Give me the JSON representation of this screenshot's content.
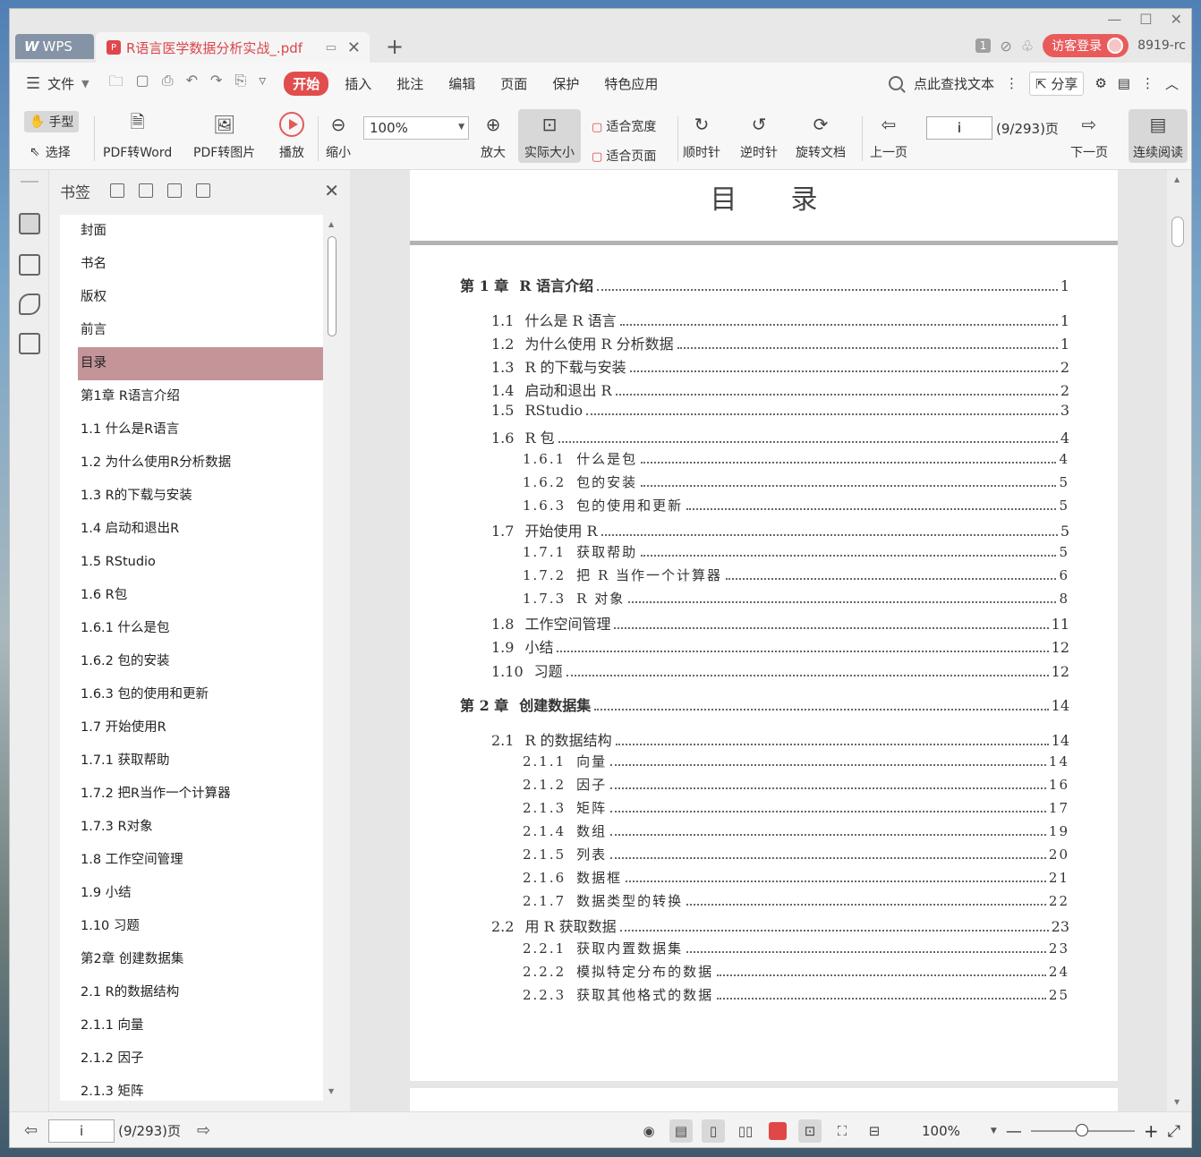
{
  "titlebar": {
    "app_name": "WPS",
    "doc_tab_title": "R语言医学数据分析实战_.pdf",
    "badge_count": "1",
    "guest_login": "访客登录",
    "user_id": "8919-rc"
  },
  "menubar": {
    "file": "文件",
    "tabs": [
      "开始",
      "插入",
      "批注",
      "编辑",
      "页面",
      "保护",
      "特色应用"
    ],
    "search_text": "点此查找文本",
    "share": "分享"
  },
  "toolbar": {
    "hand": "手型",
    "select": "选择",
    "pdf_to_word": "PDF转Word",
    "pdf_to_image": "PDF转图片",
    "play": "播放",
    "zoom_out": "缩小",
    "zoom_value": "100%",
    "zoom_in": "放大",
    "actual_size": "实际大小",
    "fit_width": "适合宽度",
    "fit_page": "适合页面",
    "clockwise": "顺时针",
    "counterclockwise": "逆时针",
    "rotate_doc": "旋转文档",
    "prev_page": "上一页",
    "page_input": "i",
    "page_count": "(9/293)页",
    "next_page": "下一页",
    "continuous": "连续阅读"
  },
  "panel": {
    "title": "书签",
    "bookmarks": [
      "封面",
      "书名",
      "版权",
      "前言",
      "目录",
      "第1章  R语言介绍",
      "1.1  什么是R语言",
      "1.2  为什么使用R分析数据",
      "1.3  R的下载与安装",
      "1.4  启动和退出R",
      "1.5  RStudio",
      "1.6  R包",
      "1.6.1  什么是包",
      "1.6.2  包的安装",
      "1.6.3  包的使用和更新",
      "1.7  开始使用R",
      "1.7.1  获取帮助",
      "1.7.2  把R当作一个计算器",
      "1.7.3  R对象",
      "1.8  工作空间管理",
      "1.9  小结",
      "1.10  习题",
      "第2章  创建数据集",
      "2.1  R的数据结构",
      "2.1.1  向量",
      "2.1.2  因子",
      "2.1.3  矩阵"
    ],
    "selected_index": 4
  },
  "document": {
    "page_title": "目录",
    "toc": [
      {
        "level": 0,
        "num": "第 1 章",
        "text": "R 语言介绍",
        "page": "1"
      },
      {
        "level": 1,
        "num": "1.1",
        "text": "什么是 R 语言",
        "page": "1"
      },
      {
        "level": 1,
        "num": "1.2",
        "text": "为什么使用 R 分析数据",
        "page": "1"
      },
      {
        "level": 1,
        "num": "1.3",
        "text": "R 的下载与安装",
        "page": "2"
      },
      {
        "level": 1,
        "num": "1.4",
        "text": "启动和退出 R",
        "page": "2"
      },
      {
        "level": 1,
        "num": "1.5",
        "text": "RStudio",
        "page": "3"
      },
      {
        "level": 1,
        "num": "1.6",
        "text": "R 包",
        "page": "4"
      },
      {
        "level": 2,
        "num": "1.6.1",
        "text": "什么是包",
        "page": "4"
      },
      {
        "level": 2,
        "num": "1.6.2",
        "text": "包的安装",
        "page": "5"
      },
      {
        "level": 2,
        "num": "1.6.3",
        "text": "包的使用和更新",
        "page": "5"
      },
      {
        "level": 1,
        "num": "1.7",
        "text": "开始使用 R",
        "page": "5"
      },
      {
        "level": 2,
        "num": "1.7.1",
        "text": "获取帮助",
        "page": "5"
      },
      {
        "level": 2,
        "num": "1.7.2",
        "text": "把 R 当作一个计算器",
        "page": "6"
      },
      {
        "level": 2,
        "num": "1.7.3",
        "text": "R 对象",
        "page": "8"
      },
      {
        "level": 1,
        "num": "1.8",
        "text": "工作空间管理",
        "page": "11"
      },
      {
        "level": 1,
        "num": "1.9",
        "text": "小结",
        "page": "12"
      },
      {
        "level": 1,
        "num": "1.10",
        "text": "习题",
        "page": "12"
      },
      {
        "level": 0,
        "num": "第 2 章",
        "text": "创建数据集",
        "page": "14"
      },
      {
        "level": 1,
        "num": "2.1",
        "text": "R 的数据结构",
        "page": "14"
      },
      {
        "level": 2,
        "num": "2.1.1",
        "text": "向量",
        "page": "14"
      },
      {
        "level": 2,
        "num": "2.1.2",
        "text": "因子",
        "page": "16"
      },
      {
        "level": 2,
        "num": "2.1.3",
        "text": "矩阵",
        "page": "17"
      },
      {
        "level": 2,
        "num": "2.1.4",
        "text": "数组",
        "page": "19"
      },
      {
        "level": 2,
        "num": "2.1.5",
        "text": "列表",
        "page": "20"
      },
      {
        "level": 2,
        "num": "2.1.6",
        "text": "数据框",
        "page": "21"
      },
      {
        "level": 2,
        "num": "2.1.7",
        "text": "数据类型的转换",
        "page": "22"
      },
      {
        "level": 1,
        "num": "2.2",
        "text": "用 R 获取数据",
        "page": "23"
      },
      {
        "level": 2,
        "num": "2.2.1",
        "text": "获取内置数据集",
        "page": "23"
      },
      {
        "level": 2,
        "num": "2.2.2",
        "text": "模拟特定分布的数据",
        "page": "24"
      },
      {
        "level": 2,
        "num": "2.2.3",
        "text": "获取其他格式的数据",
        "page": "25"
      }
    ]
  },
  "statusbar": {
    "page_input": "i",
    "page_count": "(9/293)页",
    "zoom": "100%"
  }
}
